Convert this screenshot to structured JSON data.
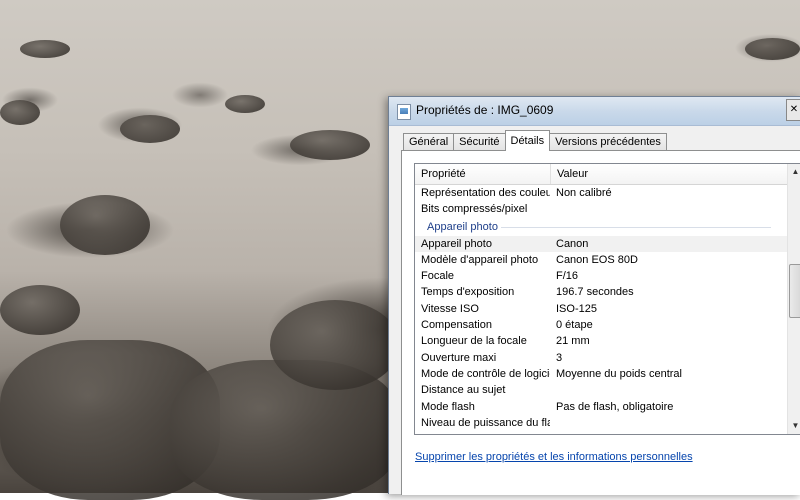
{
  "window": {
    "title": "Propriétés de : IMG_0609"
  },
  "tabs": [
    {
      "label": "Général",
      "active": false
    },
    {
      "label": "Sécurité",
      "active": false
    },
    {
      "label": "Détails",
      "active": true
    },
    {
      "label": "Versions précédentes",
      "active": false
    }
  ],
  "list": {
    "headers": {
      "property": "Propriété",
      "value": "Valeur"
    },
    "rows_before_group": [
      {
        "property": "Représentation des couleurs",
        "value": "Non calibré"
      },
      {
        "property": "Bits compressés/pixel",
        "value": ""
      }
    ],
    "group_heading": "Appareil photo",
    "rows": [
      {
        "property": "Appareil photo",
        "value": "Canon",
        "selected": true
      },
      {
        "property": "Modèle d'appareil photo",
        "value": "Canon EOS 80D"
      },
      {
        "property": "Focale",
        "value": "F/16"
      },
      {
        "property": "Temps d'exposition",
        "value": "196.7 secondes"
      },
      {
        "property": "Vitesse ISO",
        "value": "ISO-125"
      },
      {
        "property": "Compensation",
        "value": "0 étape"
      },
      {
        "property": "Longueur de la focale",
        "value": "21 mm"
      },
      {
        "property": "Ouverture maxi",
        "value": "3"
      },
      {
        "property": "Mode de contrôle de logiciel",
        "value": "Moyenne du poids central"
      },
      {
        "property": "Distance au sujet",
        "value": ""
      },
      {
        "property": "Mode flash",
        "value": "Pas de flash, obligatoire"
      },
      {
        "property": "Niveau de puissance du flash",
        "value": ""
      }
    ]
  },
  "footer": {
    "link_label": "Supprimer les propriétés et les informations personnelles"
  },
  "icons": {
    "window_icon": "properties-window-icon",
    "scroll_up": "▲",
    "scroll_down": "▼"
  },
  "colors": {
    "link": "#0645ad",
    "group_heading": "#1e3f8a",
    "title_bar": "#cad9ea"
  }
}
